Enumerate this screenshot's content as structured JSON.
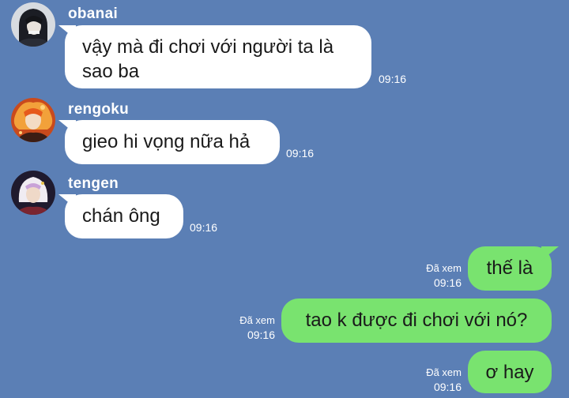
{
  "messages": [
    {
      "sender": "obanai",
      "text": "vậy mà đi chơi với người ta là sao ba",
      "time": "09:16"
    },
    {
      "sender": "rengoku",
      "text": "gieo hi vọng nữa hả",
      "time": "09:16"
    },
    {
      "sender": "tengen",
      "text": "chán ông",
      "time": "09:16"
    },
    {
      "text": "thế là",
      "seen": "Đã xem",
      "time": "09:16"
    },
    {
      "text": "tao k được đi chơi với nó?",
      "seen": "Đã xem",
      "time": "09:16"
    },
    {
      "text": "ơ hay",
      "seen": "Đã xem",
      "time": "09:16"
    }
  ],
  "theme": {
    "background": "#5b7fb5",
    "incoming_bubble": "#ffffff",
    "outgoing_bubble": "#79e36f"
  },
  "icons": {
    "obanai_avatar": "avatar-obanai",
    "rengoku_avatar": "avatar-rengoku",
    "tengen_avatar": "avatar-tengen"
  }
}
